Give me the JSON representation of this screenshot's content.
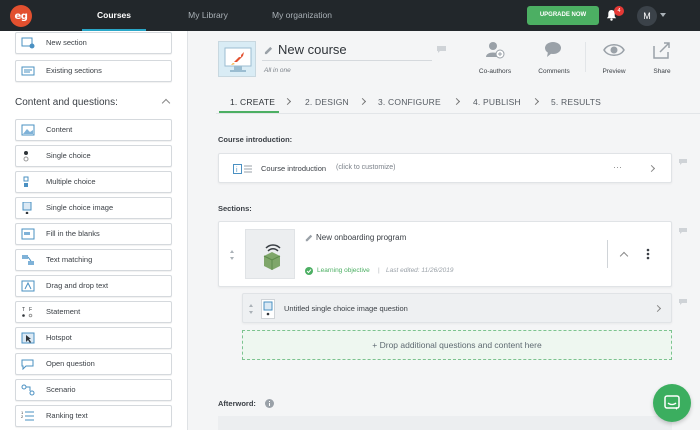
{
  "topbar": {
    "logo_text": "eg",
    "tabs": [
      {
        "label": "Courses",
        "active": true
      },
      {
        "label": "My Library",
        "active": false
      },
      {
        "label": "My organization",
        "active": false
      }
    ],
    "upgrade_label": "UPGRADE NOW",
    "notification_count": "4",
    "avatar_initial": "M"
  },
  "sidebar": {
    "top_items": [
      {
        "label": "New section",
        "icon": "new-section-icon"
      },
      {
        "label": "Existing sections",
        "icon": "existing-sections-icon"
      }
    ],
    "heading": "Content and questions:",
    "items": [
      {
        "label": "Content",
        "icon": "content-icon"
      },
      {
        "label": "Single choice",
        "icon": "single-choice-icon"
      },
      {
        "label": "Multiple choice",
        "icon": "multiple-choice-icon"
      },
      {
        "label": "Single choice image",
        "icon": "single-choice-image-icon"
      },
      {
        "label": "Fill in the blanks",
        "icon": "fill-in-blanks-icon"
      },
      {
        "label": "Text matching",
        "icon": "text-matching-icon"
      },
      {
        "label": "Drag and drop text",
        "icon": "drag-drop-text-icon"
      },
      {
        "label": "Statement",
        "icon": "statement-icon"
      },
      {
        "label": "Hotspot",
        "icon": "hotspot-icon"
      },
      {
        "label": "Open question",
        "icon": "open-question-icon"
      },
      {
        "label": "Scenario",
        "icon": "scenario-icon"
      },
      {
        "label": "Ranking text",
        "icon": "ranking-text-icon"
      }
    ]
  },
  "course": {
    "title": "New course",
    "subtitle": "All in one"
  },
  "toolbar": {
    "coauthors": "Co-authors",
    "comments": "Comments",
    "preview": "Preview",
    "share": "Share"
  },
  "steps": [
    {
      "label": "1. CREATE",
      "active": true
    },
    {
      "label": "2. DESIGN",
      "active": false
    },
    {
      "label": "3. CONFIGURE",
      "active": false
    },
    {
      "label": "4. PUBLISH",
      "active": false
    },
    {
      "label": "5. RESULTS",
      "active": false
    }
  ],
  "intro": {
    "heading": "Course introduction:",
    "title": "Course introduction",
    "hint": "(click to customize)",
    "menu": "···"
  },
  "sections": {
    "heading": "Sections:",
    "section_title": "New onboarding program",
    "objective": "Learning objective",
    "separator": "|",
    "last_edited": "Last edited: 11/26/2019",
    "question_title": "Untitled single choice image question",
    "drop_label": "+ Drop additional questions and content here"
  },
  "afterword": {
    "heading": "Afterword:"
  },
  "colors": {
    "topbar": "#22272b",
    "accent_green": "#4caf63",
    "logo": "#e2502f",
    "badge": "#e53935"
  }
}
